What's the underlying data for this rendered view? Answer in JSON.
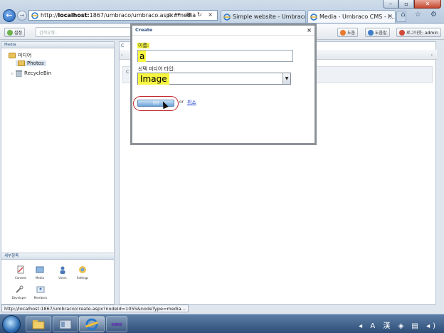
{
  "browser": {
    "url_plain": "http://",
    "url_host": "localhost:",
    "url_rest": "1867/umbraco/umbraco.aspx#media",
    "tab1_title": "Simple website - Umbraco C...",
    "tab2_title": "Media - Umbraco CMS - l...",
    "tab_close": "×",
    "addr_tools": "ρ ▾ ⊠ ↻ ×",
    "cmd_icons": "⌂ ☆ ⚙",
    "window_buttons": {
      "min": "–",
      "max": "▫",
      "close": "✕"
    },
    "back_glyph": "←",
    "fwd_glyph": "→"
  },
  "toolbar": {
    "left_button": "설정",
    "search_placeholder": "검색유형..",
    "help_button": "도움",
    "help2_button": "도움말",
    "logout_button": "로그아웃: admin"
  },
  "media_tree": {
    "header": "Media",
    "root": "미디어",
    "items": [
      "Photos",
      "RecycleBin"
    ]
  },
  "content_panel": {
    "tab_prefix": "C",
    "row_prefix": "C",
    "scroll_left": "‹",
    "scroll_right": "‹"
  },
  "sections": {
    "header": "세부항목",
    "items": [
      "Content",
      "Media",
      "Users",
      "Settings",
      "Developer",
      "Members"
    ]
  },
  "dialog": {
    "title": "Create",
    "close_glyph": "×",
    "name_label": "이름:",
    "name_value": "a",
    "type_label": "선택 미디어 타입:",
    "type_value": "Image",
    "create_button": "생성",
    "or_text": "or",
    "cancel_link": "취소"
  },
  "status": {
    "url": "http://localhost:1867/umbraco/create.aspx?nodeId=1055&nodeType=media..."
  },
  "taskbar": {
    "tray_icons": "◂ A 漢 ◈ ▤ ◂)",
    "apps": [
      "explorer",
      "file-manager",
      "internet-explorer",
      "visual-studio"
    ]
  },
  "colors": {
    "highlight": "#f6f642",
    "link": "#1a3fd6",
    "annotation_ring": "#c0262a"
  }
}
